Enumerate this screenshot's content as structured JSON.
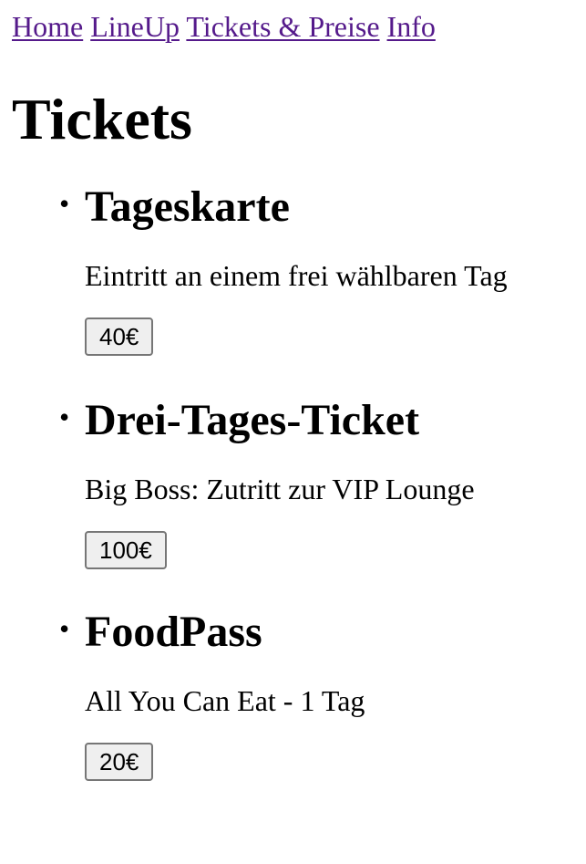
{
  "nav": {
    "links": [
      {
        "label": "Home"
      },
      {
        "label": "LineUp"
      },
      {
        "label": "Tickets & Preise"
      },
      {
        "label": "Info"
      }
    ]
  },
  "page_title": "Tickets",
  "bullet_glyph": "•",
  "tickets": [
    {
      "name": "Tageskarte",
      "description": "Eintritt an einem frei wählbaren Tag",
      "price": "40€"
    },
    {
      "name": "Drei-Tages-Ticket",
      "description": "Big Boss: Zutritt zur VIP Lounge",
      "price": "100€"
    },
    {
      "name": "FoodPass",
      "description": "All You Can Eat - 1 Tag",
      "price": "20€"
    }
  ],
  "colors": {
    "link": "#551a8b",
    "button_bg": "#efefef",
    "button_border": "#767676"
  }
}
